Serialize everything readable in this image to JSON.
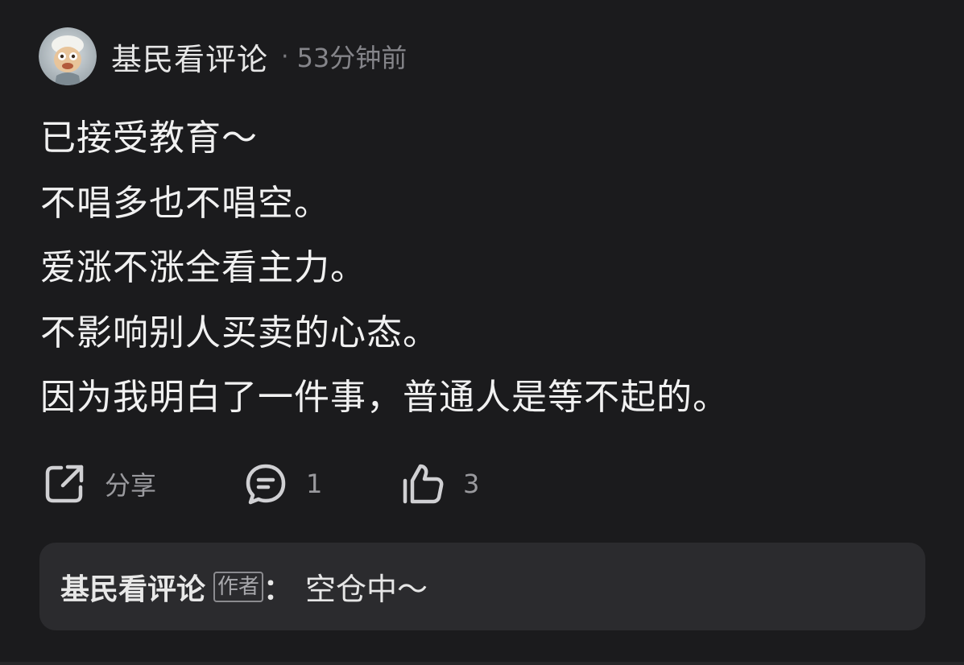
{
  "post": {
    "author": "基民看评论",
    "separator": "·",
    "time": "53分钟前",
    "avatar_icon": "cartoon-avatar-icon",
    "content_lines": [
      "已接受教育～",
      "不唱多也不唱空。",
      "爱涨不涨全看主力。",
      "不影响别人买卖的心态。",
      "因为我明白了一件事，普通人是等不起的。"
    ]
  },
  "actions": {
    "share_label": "分享",
    "share_icon": "share-icon",
    "comment_count": "1",
    "comment_icon": "comment-icon",
    "like_count": "3",
    "like_icon": "thumbs-up-icon"
  },
  "reply": {
    "name": "基民看评论",
    "badge": "作者",
    "colon": "：",
    "text": "空仓中～"
  },
  "colors": {
    "background": "#1b1b1d",
    "reply_background": "#2b2b2e",
    "text_primary": "#f1f1f1",
    "text_secondary": "#85858a"
  }
}
